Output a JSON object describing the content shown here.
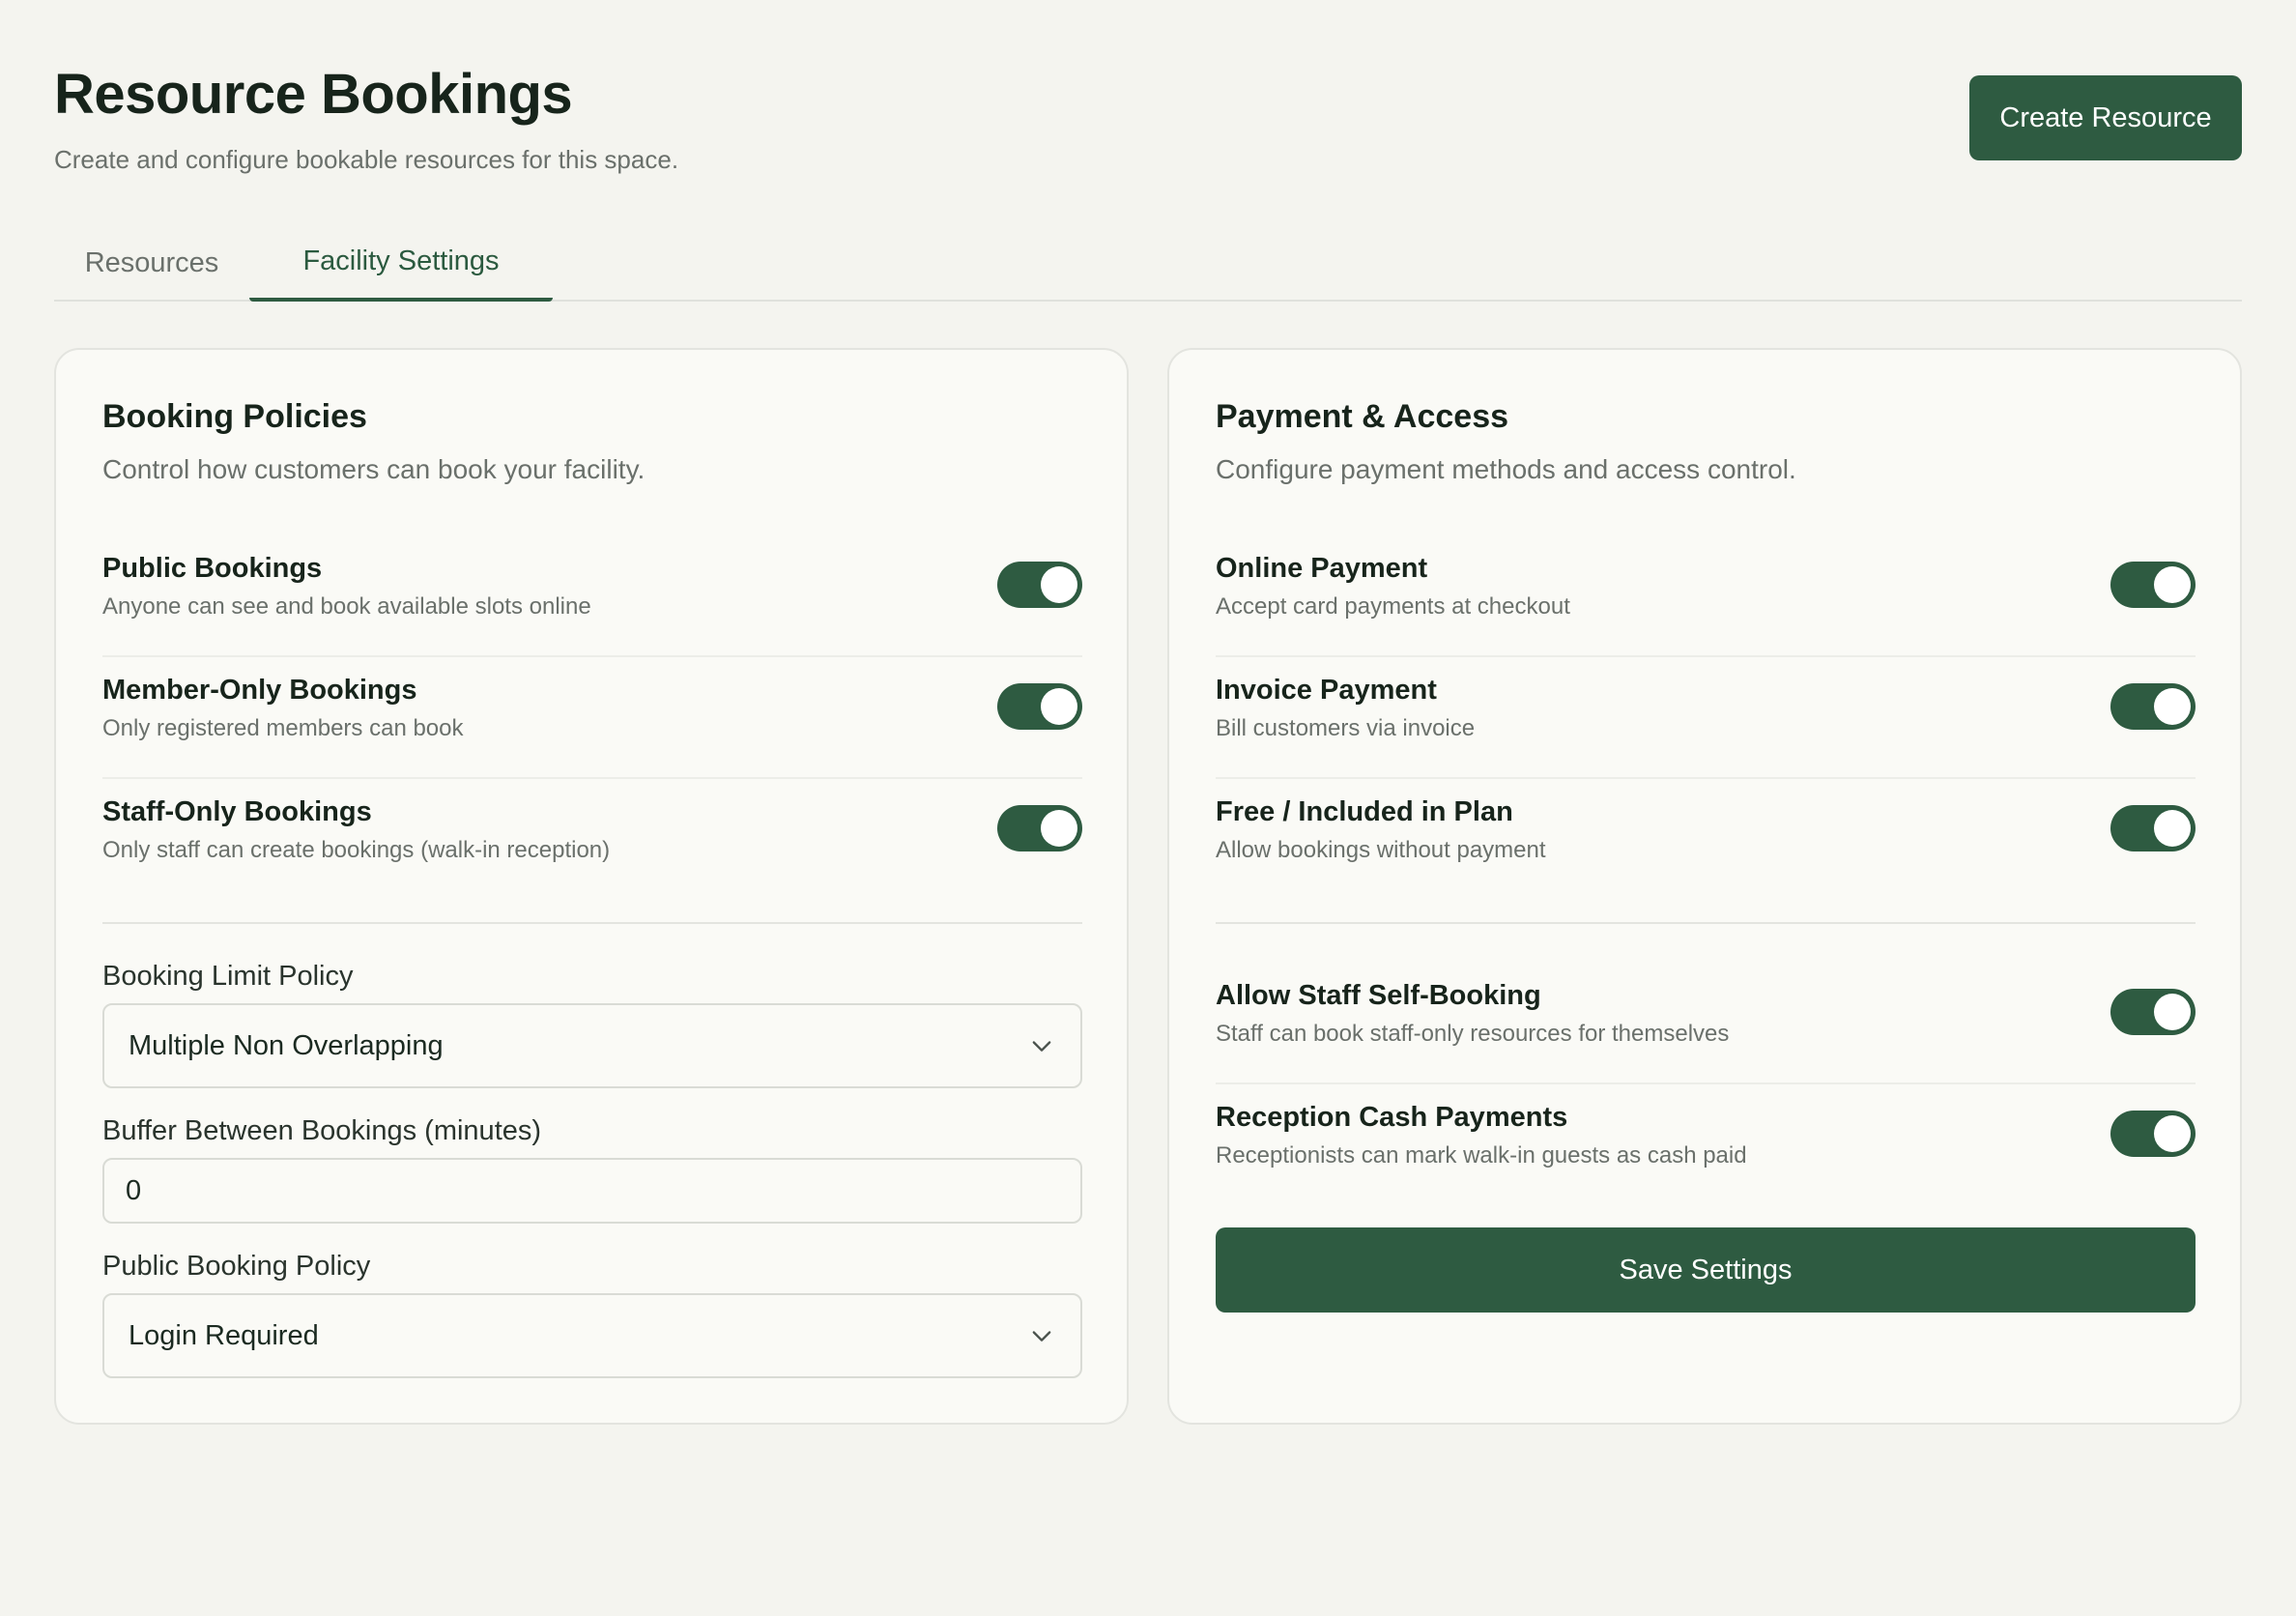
{
  "header": {
    "title": "Resource Bookings",
    "subtitle": "Create and configure bookable resources for this space.",
    "create_button": "Create Resource"
  },
  "tabs": [
    {
      "label": "Resources",
      "active": false
    },
    {
      "label": "Facility Settings",
      "active": true
    }
  ],
  "booking_policies": {
    "title": "Booking Policies",
    "description": "Control how customers can book your facility.",
    "toggles": [
      {
        "label": "Public Bookings",
        "description": "Anyone can see and book available slots online",
        "enabled": true
      },
      {
        "label": "Member-Only Bookings",
        "description": "Only registered members can book",
        "enabled": true
      },
      {
        "label": "Staff-Only Bookings",
        "description": "Only staff can create bookings (walk-in reception)",
        "enabled": true
      }
    ],
    "booking_limit": {
      "label": "Booking Limit Policy",
      "value": "Multiple Non Overlapping"
    },
    "buffer": {
      "label": "Buffer Between Bookings (minutes)",
      "value": "0"
    },
    "public_policy": {
      "label": "Public Booking Policy",
      "value": "Login Required"
    }
  },
  "payment_access": {
    "title": "Payment & Access",
    "description": "Configure payment methods and access control.",
    "payment_toggles": [
      {
        "label": "Online Payment",
        "description": "Accept card payments at checkout",
        "enabled": true
      },
      {
        "label": "Invoice Payment",
        "description": "Bill customers via invoice",
        "enabled": true
      },
      {
        "label": "Free / Included in Plan",
        "description": "Allow bookings without payment",
        "enabled": true
      }
    ],
    "access_toggles": [
      {
        "label": "Allow Staff Self-Booking",
        "description": "Staff can book staff-only resources for themselves",
        "enabled": true
      },
      {
        "label": "Reception Cash Payments",
        "description": "Receptionists can mark walk-in guests as cash paid",
        "enabled": true
      }
    ],
    "save_button": "Save Settings"
  },
  "colors": {
    "accent": "#2e5b41",
    "background": "#f4f4ef",
    "card": "#fafaf6"
  }
}
